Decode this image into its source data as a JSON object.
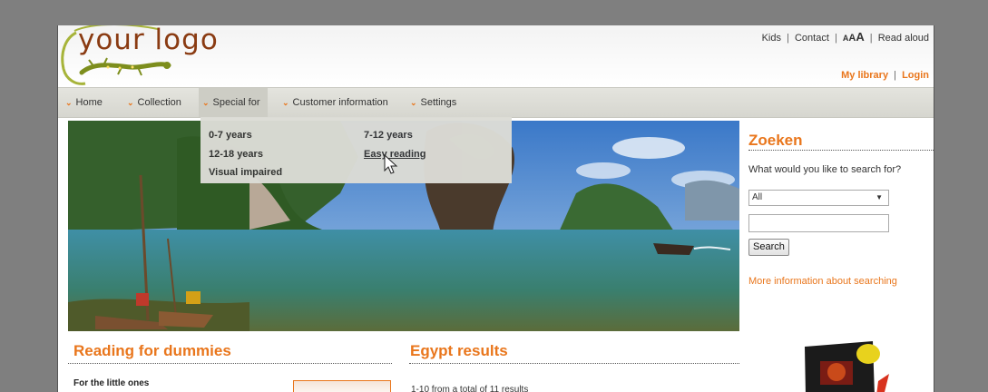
{
  "header": {
    "logo": {
      "text": "your logo"
    },
    "toplinks": {
      "kids": "Kids",
      "contact": "Contact",
      "aaa": [
        "A",
        "A",
        "A"
      ],
      "read_aloud": "Read aloud",
      "separator": "|"
    },
    "userlinks": {
      "my_library": "My library",
      "login": "Login",
      "separator": "|"
    }
  },
  "nav": {
    "items": [
      {
        "label": "Home"
      },
      {
        "label": "Collection"
      },
      {
        "label": "Special for"
      },
      {
        "label": "Customer information"
      },
      {
        "label": "Settings"
      }
    ],
    "chevron": "⌄",
    "active": "Special for"
  },
  "dropdown": {
    "items": [
      {
        "label": "0-7 years"
      },
      {
        "label": "7-12 years"
      },
      {
        "label": "12-18 years"
      },
      {
        "label": "Easy reading"
      },
      {
        "label": "Visual impaired"
      }
    ],
    "hovered": "Easy reading"
  },
  "sidebar": {
    "title": "Zoeken",
    "prompt": "What would you like to search for?",
    "select_value": "All",
    "search_value": "",
    "button": "Search",
    "more_link": "More information about searching"
  },
  "content": {
    "left_title": "Reading for dummies",
    "left_subtitle": "For the little ones",
    "mid_title": "Egypt results",
    "mid_text": "1-10 from a total of 11 results"
  },
  "colors": {
    "accent": "#e9761c",
    "logo": "#8a3b12",
    "background": "#7f7f7f",
    "navbar": "#dcdcd6"
  },
  "icons": [
    "gecko-logo-icon",
    "chevron-down-icon",
    "mouse-cursor-icon",
    "dropdown-arrow-icon"
  ]
}
